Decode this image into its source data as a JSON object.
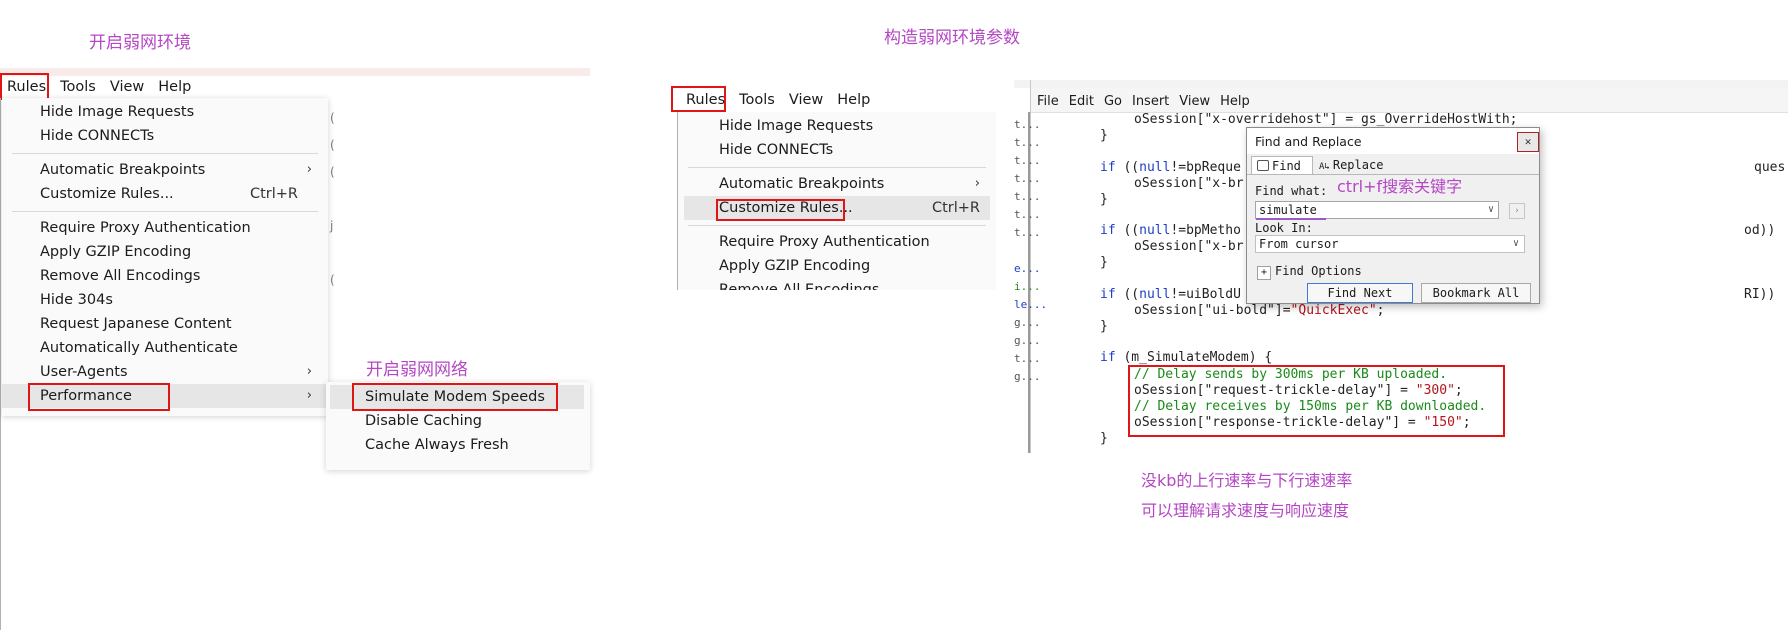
{
  "annotations": {
    "left_title": "开启弱网环境",
    "right_title": "构造弱网环境参数",
    "sub_label": "开启弱网网络",
    "search_tip": "ctrl+f搜索关键字",
    "note_line1": "没kb的上行速率与下行速速率",
    "note_line2": "可以理解请求速度与响应速度"
  },
  "menubar": [
    "Rules",
    "Tools",
    "View",
    "Help"
  ],
  "rules_menu": {
    "items": [
      {
        "label": "Hide Image Requests"
      },
      {
        "label": "Hide CONNECTs"
      },
      {
        "label": "Automatic Breakpoints",
        "arrow": "›"
      },
      {
        "label": "Customize Rules...",
        "shortcut": "Ctrl+R"
      },
      {
        "label": "Require Proxy Authentication"
      },
      {
        "label": "Apply GZIP Encoding"
      },
      {
        "label": "Remove All Encodings"
      },
      {
        "label": "Hide 304s"
      },
      {
        "label": "Request Japanese Content"
      },
      {
        "label": "Automatically Authenticate"
      },
      {
        "label": "User-Agents",
        "arrow": "›"
      },
      {
        "label": "Performance",
        "arrow": "›"
      }
    ]
  },
  "performance_submenu": {
    "items": [
      "Simulate Modem Speeds",
      "Disable Caching",
      "Cache Always Fresh"
    ]
  },
  "rules_menu_2": {
    "items": [
      {
        "label": "Hide Image Requests"
      },
      {
        "label": "Hide CONNECTs"
      },
      {
        "label": "Automatic Breakpoints",
        "arrow": "›"
      },
      {
        "label": "Customize Rules...",
        "shortcut": "Ctrl+R"
      },
      {
        "label": "Require Proxy Authentication"
      },
      {
        "label": "Apply GZIP Encoding"
      },
      {
        "label": "Remove All Encodings"
      }
    ]
  },
  "editor_menubar": [
    "File",
    "Edit",
    "Go",
    "Insert",
    "View",
    "Help"
  ],
  "code_lines": {
    "l1": "oSession[\"x-overridehost\"] = gs_OverrideHostWith;",
    "l2": "}",
    "l3a": "if",
    "l3b": " ((",
    "l3c": "null",
    "l3d": "!=bpReque",
    "l3e": "ques",
    "l4": "oSession[\"x-br",
    "l5": "}",
    "l6a": "if",
    "l6b": " ((",
    "l6c": "null",
    "l6d": "!=bpMetho",
    "l6e": "od))",
    "l7": "oSession[\"x-br",
    "l8": "}",
    "l9a": "if",
    "l9b": " ((",
    "l9c": "null",
    "l9d": "!=uiBoldU",
    "l9e": "RI))",
    "l10a": "oSession[\"ui-bold\"]=",
    "l10b": "\"QuickExec\"",
    "l10c": ";",
    "l11": "}",
    "l12a": "if",
    "l12b": " (m_SimulateModem) {",
    "c1": "// Delay sends by 300ms per KB uploaded.",
    "c2a": "oSession[\"request-trickle-delay\"] = ",
    "c2b": "\"300\"",
    "c2c": ";",
    "c3": "// Delay receives by 150ms per KB downloaded.",
    "c4a": "oSession[\"response-trickle-delay\"] = ",
    "c4b": "\"150\"",
    "c4c": ";",
    "l13": "}"
  },
  "gutter": [
    "t...",
    "t...",
    "t...",
    "t...",
    "t...",
    "t...",
    "t...",
    "",
    "e...",
    "i...",
    "le...",
    "g...",
    "g...",
    "t...",
    "g..."
  ],
  "find_dialog": {
    "title": "Find and Replace",
    "close": "✕",
    "tab_find": "Find",
    "tab_replace": "Replace",
    "find_what_label": "Find what:",
    "find_value": "simulate",
    "look_in_label": "Look In:",
    "look_in_value": "From cursor",
    "find_options": "Find Options",
    "find_next": "Find Next",
    "bookmark_all": "Bookmark All"
  },
  "colors": {
    "annotation": "#b547c4",
    "highlight_box": "#e01515",
    "keyword": "#1f3fc8",
    "string": "#b4141c",
    "comment": "#1a8a1a"
  }
}
